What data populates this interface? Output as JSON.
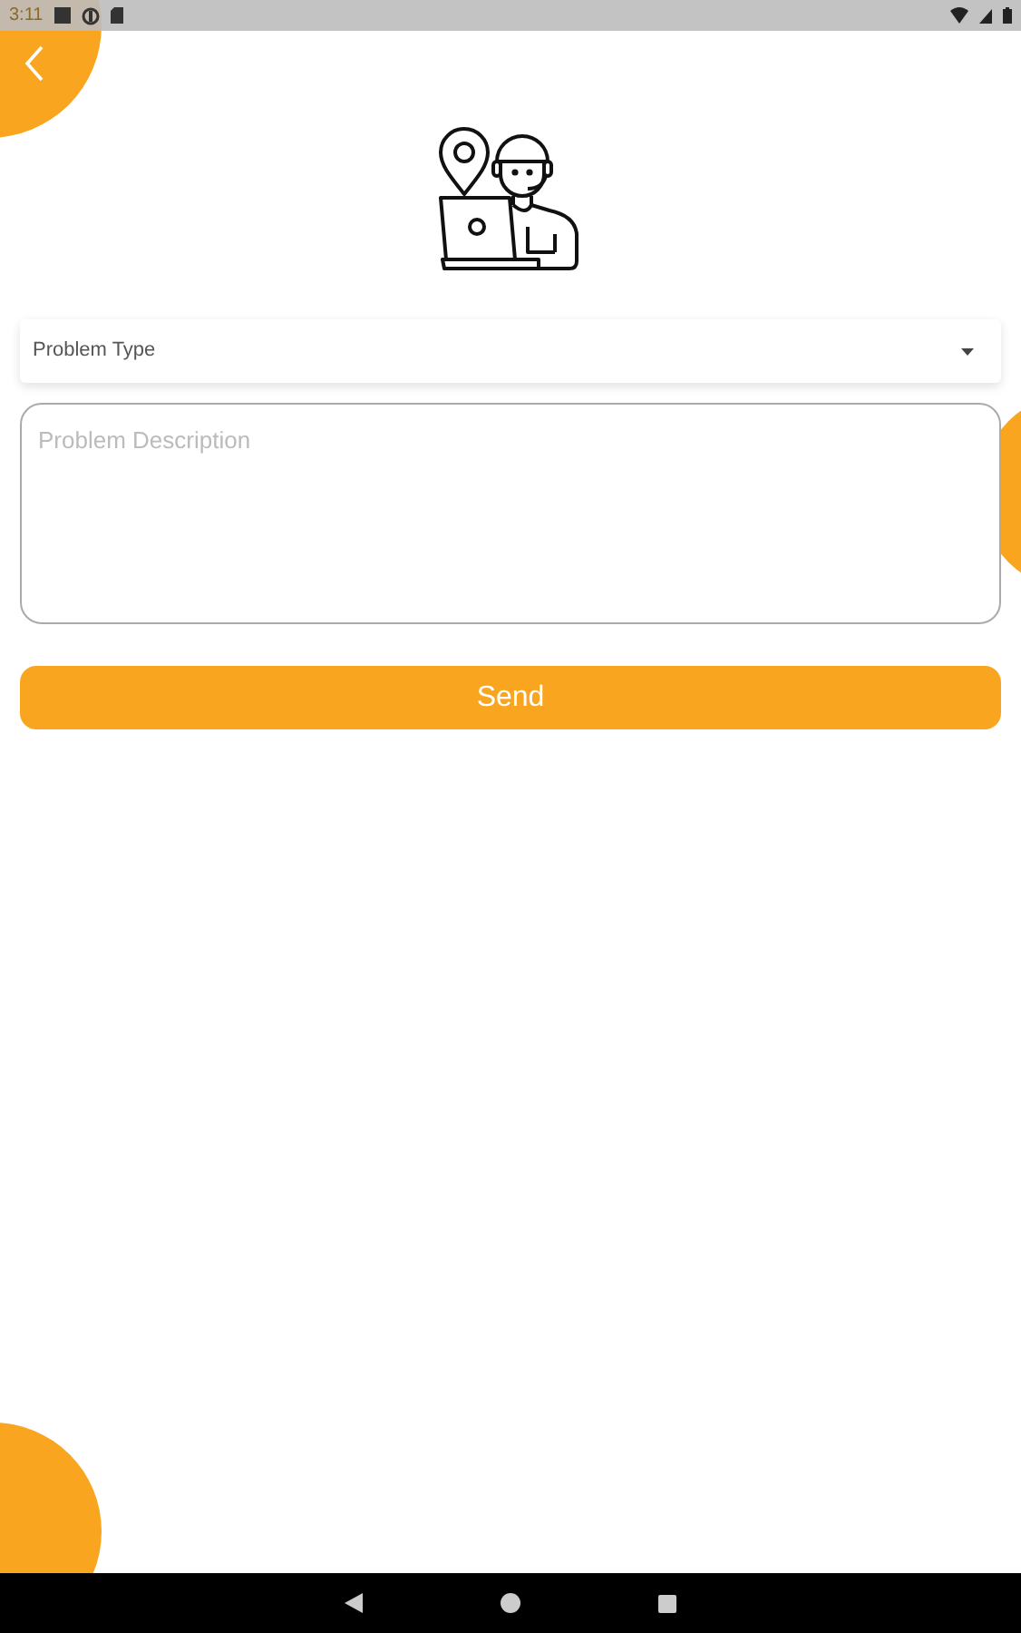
{
  "status_bar": {
    "time": "3:11"
  },
  "form": {
    "problem_type": {
      "placeholder": "Problem Type"
    },
    "description": {
      "placeholder": "Problem Description"
    },
    "submit": {
      "label": "Send"
    }
  }
}
